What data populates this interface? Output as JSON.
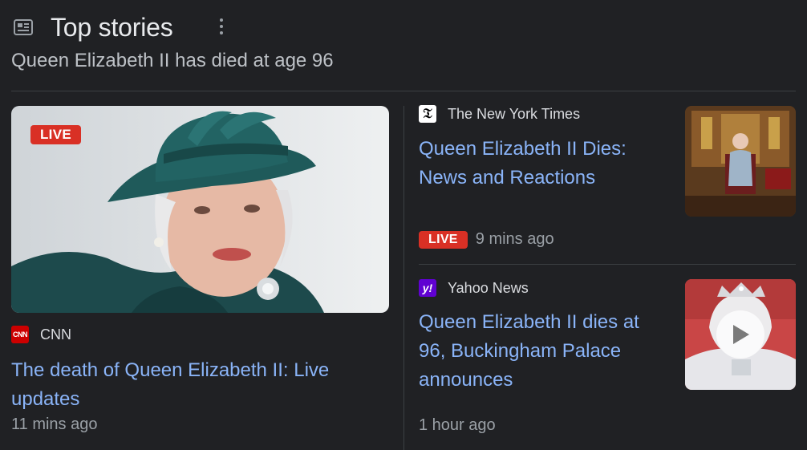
{
  "header": {
    "icon": "newspaper-icon",
    "title": "Top stories",
    "more_icon": "more-vert-icon"
  },
  "subtitle": "Queen Elizabeth II has died at age 96",
  "colors": {
    "background": "#202124",
    "link": "#8ab4f8",
    "live_badge": "#d93025",
    "divider": "#3c4043",
    "meta_text": "#9aa0a6"
  },
  "stories": [
    {
      "badge": "LIVE",
      "source": "CNN",
      "source_icon": "cnn-logo-icon",
      "headline": "The death of Queen Elizabeth II: Live updates",
      "time": "11 mins ago",
      "image": "queen-portrait-teal-hat"
    },
    {
      "source": "The New York Times",
      "source_icon": "nyt-logo-icon",
      "headline": "Queen Elizabeth II Dies: News and Reactions",
      "badge": "LIVE",
      "time": "9 mins ago",
      "image": "queen-on-throne"
    },
    {
      "source": "Yahoo News",
      "source_icon": "yahoo-logo-icon",
      "headline": "Queen Elizabeth II dies at 96, Buckingham Palace announces",
      "time": "1 hour ago",
      "image": "queen-crown-video",
      "video_icon": "play-icon"
    }
  ]
}
